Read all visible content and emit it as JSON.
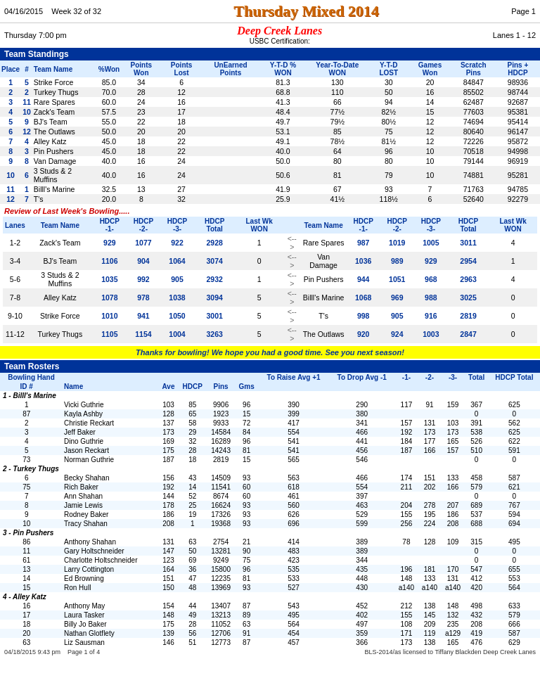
{
  "header": {
    "date": "04/16/2015",
    "week": "Week 32 of 32",
    "title": "Thursday Mixed 2014",
    "page": "Page 1",
    "day_time": "Thursday   7:00 pm",
    "lanes": "Lanes 1 - 12",
    "location": "Deep Creek Lanes",
    "usbc": "USBC Certification:"
  },
  "team_standings": {
    "section_title": "Team Standings",
    "columns": [
      "Place",
      "#",
      "Team Name",
      "%Won",
      "Points Won",
      "Points Lost",
      "UnEarned Points",
      "Y-T-D % WON",
      "Year-To-Date WON",
      "Y-T-D LOST",
      "Games Won",
      "Scratch Pins",
      "Pins + HDCP"
    ],
    "rows": [
      [
        "1",
        "5",
        "Strike Force",
        "85.0",
        "34",
        "6",
        "",
        "81.3",
        "130",
        "30",
        "20",
        "84847",
        "98936"
      ],
      [
        "2",
        "2",
        "Turkey Thugs",
        "70.0",
        "28",
        "12",
        "",
        "68.8",
        "110",
        "50",
        "16",
        "85502",
        "98744"
      ],
      [
        "3",
        "11",
        "Rare Spares",
        "60.0",
        "24",
        "16",
        "",
        "41.3",
        "66",
        "94",
        "14",
        "62487",
        "92687"
      ],
      [
        "4",
        "10",
        "Zack's Team",
        "57.5",
        "23",
        "17",
        "",
        "48.4",
        "77½",
        "82½",
        "15",
        "77603",
        "95381"
      ],
      [
        "5",
        "9",
        "BJ's Team",
        "55.0",
        "22",
        "18",
        "",
        "49.7",
        "79½",
        "80½",
        "12",
        "74694",
        "95414"
      ],
      [
        "6",
        "12",
        "The Outlaws",
        "50.0",
        "20",
        "20",
        "",
        "53.1",
        "85",
        "75",
        "12",
        "80640",
        "96147"
      ],
      [
        "7",
        "4",
        "Alley Katz",
        "45.0",
        "18",
        "22",
        "",
        "49.1",
        "78½",
        "81½",
        "12",
        "72226",
        "95872"
      ],
      [
        "8",
        "3",
        "Pin Pushers",
        "45.0",
        "18",
        "22",
        "",
        "40.0",
        "64",
        "96",
        "10",
        "70518",
        "94998"
      ],
      [
        "9",
        "8",
        "Van Damage",
        "40.0",
        "16",
        "24",
        "",
        "50.0",
        "80",
        "80",
        "10",
        "79144",
        "96919"
      ],
      [
        "10",
        "6",
        "3 Studs & 2 Muffins",
        "40.0",
        "16",
        "24",
        "",
        "50.6",
        "81",
        "79",
        "10",
        "74881",
        "95281"
      ],
      [
        "11",
        "1",
        "Billl's Marine",
        "32.5",
        "13",
        "27",
        "",
        "41.9",
        "67",
        "93",
        "7",
        "71763",
        "94785"
      ],
      [
        "12",
        "7",
        "T's",
        "20.0",
        "8",
        "32",
        "",
        "25.9",
        "41½",
        "118½",
        "6",
        "52640",
        "92279"
      ]
    ]
  },
  "review": {
    "title": "Review of Last Week's Bowling.....",
    "columns_left": [
      "Lanes",
      "Team Name",
      "HDCP -1-",
      "HDCP -2-",
      "HDCP -3-",
      "HDCP Total",
      "Last Wk WON"
    ],
    "columns_right": [
      "Team Name",
      "HDCP -1-",
      "HDCP -2-",
      "HDCP -3-",
      "HDCP Total",
      "Last Wk WON"
    ],
    "rows": [
      {
        "lanes": "1-2",
        "team1": "Zack's Team",
        "h1_1": "929",
        "h1_2": "1077",
        "h1_3": "922",
        "h1_t": "2928",
        "won1": "1",
        "arrow": "<-->",
        "team2": "Rare Spares",
        "h2_1": "987",
        "h2_2": "1019",
        "h2_3": "1005",
        "h2_t": "3011",
        "won2": "4"
      },
      {
        "lanes": "3-4",
        "team1": "BJ's Team",
        "h1_1": "1106",
        "h1_2": "904",
        "h1_3": "1064",
        "h1_t": "3074",
        "won1": "0",
        "arrow": "<-->",
        "team2": "Van Damage",
        "h2_1": "1036",
        "h2_2": "989",
        "h2_3": "929",
        "h2_t": "2954",
        "won2": "1"
      },
      {
        "lanes": "5-6",
        "team1": "3 Studs & 2 Muffins",
        "h1_1": "1035",
        "h1_2": "992",
        "h1_3": "905",
        "h1_t": "2932",
        "won1": "1",
        "arrow": "<-->",
        "team2": "Pin Pushers",
        "h2_1": "944",
        "h2_2": "1051",
        "h2_3": "968",
        "h2_t": "2963",
        "won2": "4"
      },
      {
        "lanes": "7-8",
        "team1": "Alley Katz",
        "h1_1": "1078",
        "h1_2": "978",
        "h1_3": "1038",
        "h1_t": "3094",
        "won1": "5",
        "arrow": "<-->",
        "team2": "Billl's Marine",
        "h2_1": "1068",
        "h2_2": "969",
        "h2_3": "988",
        "h2_t": "3025",
        "won2": "0"
      },
      {
        "lanes": "9-10",
        "team1": "Strike Force",
        "h1_1": "1010",
        "h1_2": "941",
        "h1_3": "1050",
        "h1_t": "3001",
        "won1": "5",
        "arrow": "<-->",
        "team2": "T's",
        "h2_1": "998",
        "h2_2": "905",
        "h2_3": "916",
        "h2_t": "2819",
        "won2": "0"
      },
      {
        "lanes": "11-12",
        "team1": "Turkey Thugs",
        "h1_1": "1105",
        "h1_2": "1154",
        "h1_3": "1004",
        "h1_t": "3263",
        "won1": "5",
        "arrow": "<-->",
        "team2": "The Outlaws",
        "h2_1": "920",
        "h2_2": "924",
        "h2_3": "1003",
        "h2_t": "2847",
        "won2": "0"
      }
    ]
  },
  "thank_you": "Thanks for bowling! We hope you had a good time. See you next season!",
  "rosters": {
    "section_title": "Team Rosters",
    "col_headers": {
      "bowling_hand": "Bowling Hand",
      "id": "ID #",
      "name": "Name",
      "ave": "Ave",
      "hdcp": "HDCP",
      "pins": "Pins",
      "gms": "Gms",
      "to_raise": "To Raise Avg +1",
      "to_drop": "To Drop Avg -1",
      "dash1": "-1-",
      "dash2": "-2-",
      "dash3": "-3-",
      "total": "Total",
      "hdcp_total": "HDCP Total"
    },
    "teams": [
      {
        "team_num": "1",
        "team_name": "Billl's Marine",
        "members": [
          {
            "id": "1",
            "name": "Vicki Guthrie",
            "ave": "103",
            "hdcp": "85",
            "pins": "9906",
            "gms": "96",
            "raise": "390",
            "drop": "290",
            "g1": "117",
            "g2": "91",
            "g3": "159",
            "total": "367",
            "hdcp_total": "625"
          },
          {
            "id": "87",
            "name": "Kayla Ashby",
            "ave": "128",
            "hdcp": "65",
            "pins": "1923",
            "gms": "15",
            "raise": "399",
            "drop": "380",
            "g1": "",
            "g2": "",
            "g3": "",
            "total": "0",
            "hdcp_total": "0"
          },
          {
            "id": "2",
            "name": "Christie Reckart",
            "ave": "137",
            "hdcp": "58",
            "pins": "9933",
            "gms": "72",
            "raise": "417",
            "drop": "341",
            "g1": "157",
            "g2": "131",
            "g3": "103",
            "total": "391",
            "hdcp_total": "562"
          },
          {
            "id": "3",
            "name": "Jeff Baker",
            "ave": "173",
            "hdcp": "29",
            "pins": "14584",
            "gms": "84",
            "raise": "554",
            "drop": "466",
            "g1": "192",
            "g2": "173",
            "g3": "173",
            "total": "538",
            "hdcp_total": "625"
          },
          {
            "id": "4",
            "name": "Dino Guthrie",
            "ave": "169",
            "hdcp": "32",
            "pins": "16289",
            "gms": "96",
            "raise": "541",
            "drop": "441",
            "g1": "184",
            "g2": "177",
            "g3": "165",
            "total": "526",
            "hdcp_total": "622"
          },
          {
            "id": "5",
            "name": "Jason Reckart",
            "ave": "175",
            "hdcp": "28",
            "pins": "14243",
            "gms": "81",
            "raise": "541",
            "drop": "456",
            "g1": "187",
            "g2": "166",
            "g3": "157",
            "total": "510",
            "hdcp_total": "591"
          },
          {
            "id": "73",
            "name": "Norman Guthrie",
            "ave": "187",
            "hdcp": "18",
            "pins": "2819",
            "gms": "15",
            "raise": "565",
            "drop": "546",
            "g1": "",
            "g2": "",
            "g3": "",
            "total": "0",
            "hdcp_total": "0"
          }
        ]
      },
      {
        "team_num": "2",
        "team_name": "Turkey Thugs",
        "members": [
          {
            "id": "6",
            "name": "Becky Shahan",
            "ave": "156",
            "hdcp": "43",
            "pins": "14509",
            "gms": "93",
            "raise": "563",
            "drop": "466",
            "g1": "174",
            "g2": "151",
            "g3": "133",
            "total": "458",
            "hdcp_total": "587"
          },
          {
            "id": "75",
            "name": "Rich Baker",
            "ave": "192",
            "hdcp": "14",
            "pins": "11541",
            "gms": "60",
            "raise": "618",
            "drop": "554",
            "g1": "211",
            "g2": "202",
            "g3": "166",
            "total": "579",
            "hdcp_total": "621"
          },
          {
            "id": "7",
            "name": "Ann Shahan",
            "ave": "144",
            "hdcp": "52",
            "pins": "8674",
            "gms": "60",
            "raise": "461",
            "drop": "397",
            "g1": "",
            "g2": "",
            "g3": "",
            "total": "0",
            "hdcp_total": "0"
          },
          {
            "id": "8",
            "name": "Jamie Lewis",
            "ave": "178",
            "hdcp": "25",
            "pins": "16624",
            "gms": "93",
            "raise": "560",
            "drop": "463",
            "g1": "204",
            "g2": "278",
            "g3": "207",
            "total": "689",
            "hdcp_total": "767"
          },
          {
            "id": "9",
            "name": "Rodney Baker",
            "ave": "186",
            "hdcp": "19",
            "pins": "17326",
            "gms": "93",
            "raise": "626",
            "drop": "529",
            "g1": "155",
            "g2": "195",
            "g3": "186",
            "total": "537",
            "hdcp_total": "594"
          },
          {
            "id": "10",
            "name": "Tracy Shahan",
            "ave": "208",
            "hdcp": "1",
            "pins": "19368",
            "gms": "93",
            "raise": "696",
            "drop": "599",
            "g1": "256",
            "g2": "224",
            "g3": "208",
            "total": "688",
            "hdcp_total": "694"
          }
        ]
      },
      {
        "team_num": "3",
        "team_name": "Pin Pushers",
        "members": [
          {
            "id": "86",
            "name": "Anthony Shahan",
            "ave": "131",
            "hdcp": "63",
            "pins": "2754",
            "gms": "21",
            "raise": "414",
            "drop": "389",
            "g1": "78",
            "g2": "128",
            "g3": "109",
            "total": "315",
            "hdcp_total": "495"
          },
          {
            "id": "11",
            "name": "Gary Holtschneider",
            "ave": "147",
            "hdcp": "50",
            "pins": "13281",
            "gms": "90",
            "raise": "483",
            "drop": "389",
            "g1": "",
            "g2": "",
            "g3": "",
            "total": "0",
            "hdcp_total": "0"
          },
          {
            "id": "61",
            "name": "Charlotte Holtschneider",
            "ave": "123",
            "hdcp": "69",
            "pins": "9249",
            "gms": "75",
            "raise": "423",
            "drop": "344",
            "g1": "",
            "g2": "",
            "g3": "",
            "total": "0",
            "hdcp_total": "0"
          },
          {
            "id": "13",
            "name": "Larry Cottington",
            "ave": "164",
            "hdcp": "36",
            "pins": "15800",
            "gms": "96",
            "raise": "535",
            "drop": "435",
            "g1": "196",
            "g2": "181",
            "g3": "170",
            "total": "547",
            "hdcp_total": "655"
          },
          {
            "id": "14",
            "name": "Ed Browning",
            "ave": "151",
            "hdcp": "47",
            "pins": "12235",
            "gms": "81",
            "raise": "533",
            "drop": "448",
            "g1": "148",
            "g2": "133",
            "g3": "131",
            "total": "412",
            "hdcp_total": "553"
          },
          {
            "id": "15",
            "name": "Ron Hull",
            "ave": "150",
            "hdcp": "48",
            "pins": "13969",
            "gms": "93",
            "raise": "527",
            "drop": "430",
            "g1": "a140",
            "g2": "a140",
            "g3": "a140",
            "total": "420",
            "hdcp_total": "564"
          }
        ]
      },
      {
        "team_num": "4",
        "team_name": "Alley Katz",
        "members": [
          {
            "id": "16",
            "name": "Anthony May",
            "ave": "154",
            "hdcp": "44",
            "pins": "13407",
            "gms": "87",
            "raise": "543",
            "drop": "452",
            "g1": "212",
            "g2": "138",
            "g3": "148",
            "total": "498",
            "hdcp_total": "633"
          },
          {
            "id": "17",
            "name": "Laura Tasker",
            "ave": "148",
            "hdcp": "49",
            "pins": "13213",
            "gms": "89",
            "raise": "495",
            "drop": "402",
            "g1": "155",
            "g2": "145",
            "g3": "132",
            "total": "432",
            "hdcp_total": "579"
          },
          {
            "id": "18",
            "name": "Billy Jo Baker",
            "ave": "175",
            "hdcp": "28",
            "pins": "11052",
            "gms": "63",
            "raise": "564",
            "drop": "497",
            "g1": "108",
            "g2": "209",
            "g3": "235",
            "total": "208",
            "hdcp_total": "666"
          },
          {
            "id": "20",
            "name": "Nathan Glotflety",
            "ave": "139",
            "hdcp": "56",
            "pins": "12706",
            "gms": "91",
            "raise": "454",
            "drop": "359",
            "g1": "171",
            "g2": "119",
            "g3": "a129",
            "total": "419",
            "hdcp_total": "587"
          },
          {
            "id": "63",
            "name": "Liz Sausman",
            "ave": "146",
            "hdcp": "51",
            "pins": "12773",
            "gms": "87",
            "raise": "457",
            "drop": "366",
            "g1": "173",
            "g2": "138",
            "g3": "165",
            "total": "476",
            "hdcp_total": "629"
          }
        ]
      }
    ]
  },
  "footer": {
    "date_time": "04/18/2015  9:43 pm",
    "page_info": "Page 1 of 4",
    "copyright": "BLS-2014/as licensed to Tiffany Blackden  Deep Creek Lanes"
  }
}
